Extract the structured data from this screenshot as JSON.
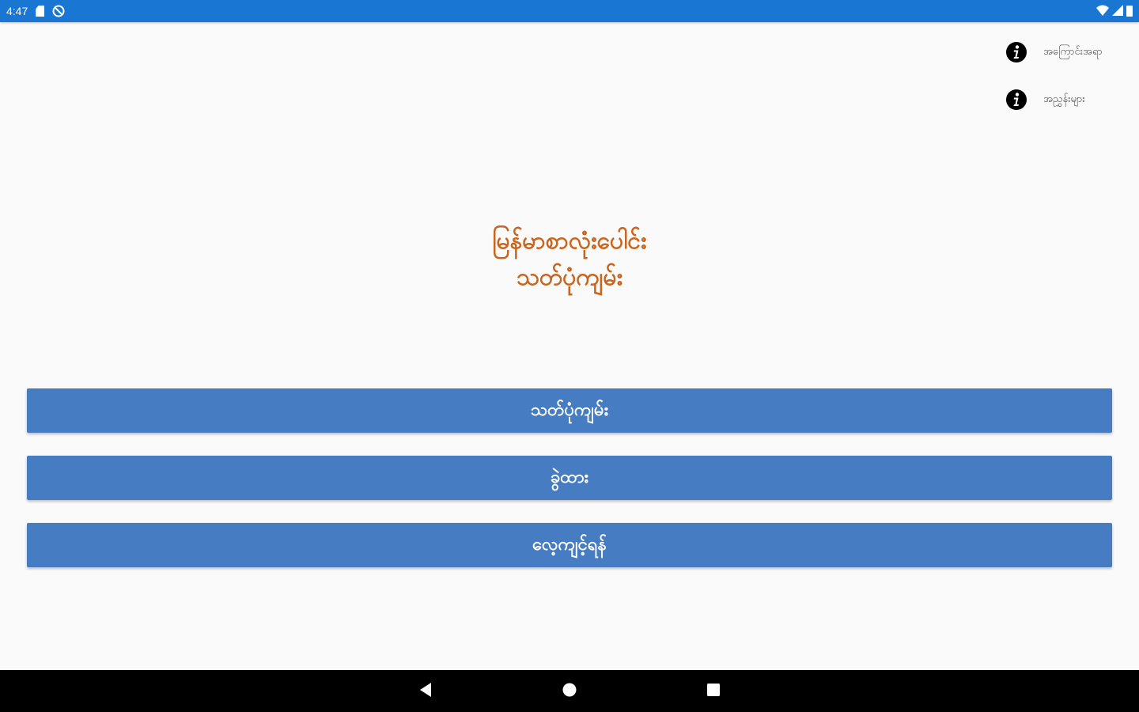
{
  "status_bar": {
    "time": "4:47",
    "icons": [
      "sd-card-icon",
      "blocked-icon",
      "wifi-icon",
      "signal-icon",
      "battery-icon"
    ],
    "color": "#1976d2"
  },
  "menu": {
    "about": {
      "label": "အကြောင်းအရာ",
      "icon": "info-icon"
    },
    "help": {
      "label": "အညွှန်းများ",
      "icon": "info-icon"
    }
  },
  "title": {
    "line1": "မြန်မာစာလုံးပေါင်း",
    "line2": "သတ်ပုံကျမ်း",
    "color": "#c8651e"
  },
  "buttons": {
    "dictionary": "သတ်ပုံကျမ်း",
    "search": "ခွဲထား",
    "practice": "လေ့ကျင့်ရန်",
    "color": "#467cc2"
  },
  "nav_bar": {
    "icons": [
      "back-icon",
      "home-icon",
      "recents-icon"
    ]
  }
}
